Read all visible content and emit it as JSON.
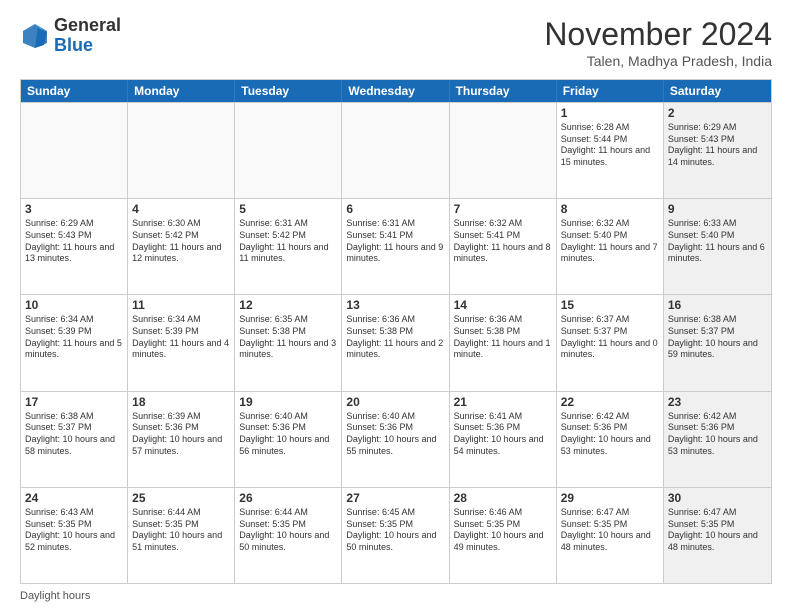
{
  "logo": {
    "general": "General",
    "blue": "Blue"
  },
  "header": {
    "month": "November 2024",
    "location": "Talen, Madhya Pradesh, India"
  },
  "days": [
    "Sunday",
    "Monday",
    "Tuesday",
    "Wednesday",
    "Thursday",
    "Friday",
    "Saturday"
  ],
  "footer": "Daylight hours",
  "weeks": [
    [
      {
        "day": "",
        "empty": true
      },
      {
        "day": "",
        "empty": true
      },
      {
        "day": "",
        "empty": true
      },
      {
        "day": "",
        "empty": true
      },
      {
        "day": "",
        "empty": true
      },
      {
        "day": "1",
        "info": "Sunrise: 6:28 AM\nSunset: 5:44 PM\nDaylight: 11 hours and 15 minutes."
      },
      {
        "day": "2",
        "info": "Sunrise: 6:29 AM\nSunset: 5:43 PM\nDaylight: 11 hours and 14 minutes.",
        "shaded": true
      }
    ],
    [
      {
        "day": "3",
        "info": "Sunrise: 6:29 AM\nSunset: 5:43 PM\nDaylight: 11 hours and 13 minutes."
      },
      {
        "day": "4",
        "info": "Sunrise: 6:30 AM\nSunset: 5:42 PM\nDaylight: 11 hours and 12 minutes."
      },
      {
        "day": "5",
        "info": "Sunrise: 6:31 AM\nSunset: 5:42 PM\nDaylight: 11 hours and 11 minutes."
      },
      {
        "day": "6",
        "info": "Sunrise: 6:31 AM\nSunset: 5:41 PM\nDaylight: 11 hours and 9 minutes."
      },
      {
        "day": "7",
        "info": "Sunrise: 6:32 AM\nSunset: 5:41 PM\nDaylight: 11 hours and 8 minutes."
      },
      {
        "day": "8",
        "info": "Sunrise: 6:32 AM\nSunset: 5:40 PM\nDaylight: 11 hours and 7 minutes."
      },
      {
        "day": "9",
        "info": "Sunrise: 6:33 AM\nSunset: 5:40 PM\nDaylight: 11 hours and 6 minutes.",
        "shaded": true
      }
    ],
    [
      {
        "day": "10",
        "info": "Sunrise: 6:34 AM\nSunset: 5:39 PM\nDaylight: 11 hours and 5 minutes."
      },
      {
        "day": "11",
        "info": "Sunrise: 6:34 AM\nSunset: 5:39 PM\nDaylight: 11 hours and 4 minutes."
      },
      {
        "day": "12",
        "info": "Sunrise: 6:35 AM\nSunset: 5:38 PM\nDaylight: 11 hours and 3 minutes."
      },
      {
        "day": "13",
        "info": "Sunrise: 6:36 AM\nSunset: 5:38 PM\nDaylight: 11 hours and 2 minutes."
      },
      {
        "day": "14",
        "info": "Sunrise: 6:36 AM\nSunset: 5:38 PM\nDaylight: 11 hours and 1 minute."
      },
      {
        "day": "15",
        "info": "Sunrise: 6:37 AM\nSunset: 5:37 PM\nDaylight: 11 hours and 0 minutes."
      },
      {
        "day": "16",
        "info": "Sunrise: 6:38 AM\nSunset: 5:37 PM\nDaylight: 10 hours and 59 minutes.",
        "shaded": true
      }
    ],
    [
      {
        "day": "17",
        "info": "Sunrise: 6:38 AM\nSunset: 5:37 PM\nDaylight: 10 hours and 58 minutes."
      },
      {
        "day": "18",
        "info": "Sunrise: 6:39 AM\nSunset: 5:36 PM\nDaylight: 10 hours and 57 minutes."
      },
      {
        "day": "19",
        "info": "Sunrise: 6:40 AM\nSunset: 5:36 PM\nDaylight: 10 hours and 56 minutes."
      },
      {
        "day": "20",
        "info": "Sunrise: 6:40 AM\nSunset: 5:36 PM\nDaylight: 10 hours and 55 minutes."
      },
      {
        "day": "21",
        "info": "Sunrise: 6:41 AM\nSunset: 5:36 PM\nDaylight: 10 hours and 54 minutes."
      },
      {
        "day": "22",
        "info": "Sunrise: 6:42 AM\nSunset: 5:36 PM\nDaylight: 10 hours and 53 minutes."
      },
      {
        "day": "23",
        "info": "Sunrise: 6:42 AM\nSunset: 5:36 PM\nDaylight: 10 hours and 53 minutes.",
        "shaded": true
      }
    ],
    [
      {
        "day": "24",
        "info": "Sunrise: 6:43 AM\nSunset: 5:35 PM\nDaylight: 10 hours and 52 minutes."
      },
      {
        "day": "25",
        "info": "Sunrise: 6:44 AM\nSunset: 5:35 PM\nDaylight: 10 hours and 51 minutes."
      },
      {
        "day": "26",
        "info": "Sunrise: 6:44 AM\nSunset: 5:35 PM\nDaylight: 10 hours and 50 minutes."
      },
      {
        "day": "27",
        "info": "Sunrise: 6:45 AM\nSunset: 5:35 PM\nDaylight: 10 hours and 50 minutes."
      },
      {
        "day": "28",
        "info": "Sunrise: 6:46 AM\nSunset: 5:35 PM\nDaylight: 10 hours and 49 minutes."
      },
      {
        "day": "29",
        "info": "Sunrise: 6:47 AM\nSunset: 5:35 PM\nDaylight: 10 hours and 48 minutes."
      },
      {
        "day": "30",
        "info": "Sunrise: 6:47 AM\nSunset: 5:35 PM\nDaylight: 10 hours and 48 minutes.",
        "shaded": true
      }
    ]
  ]
}
